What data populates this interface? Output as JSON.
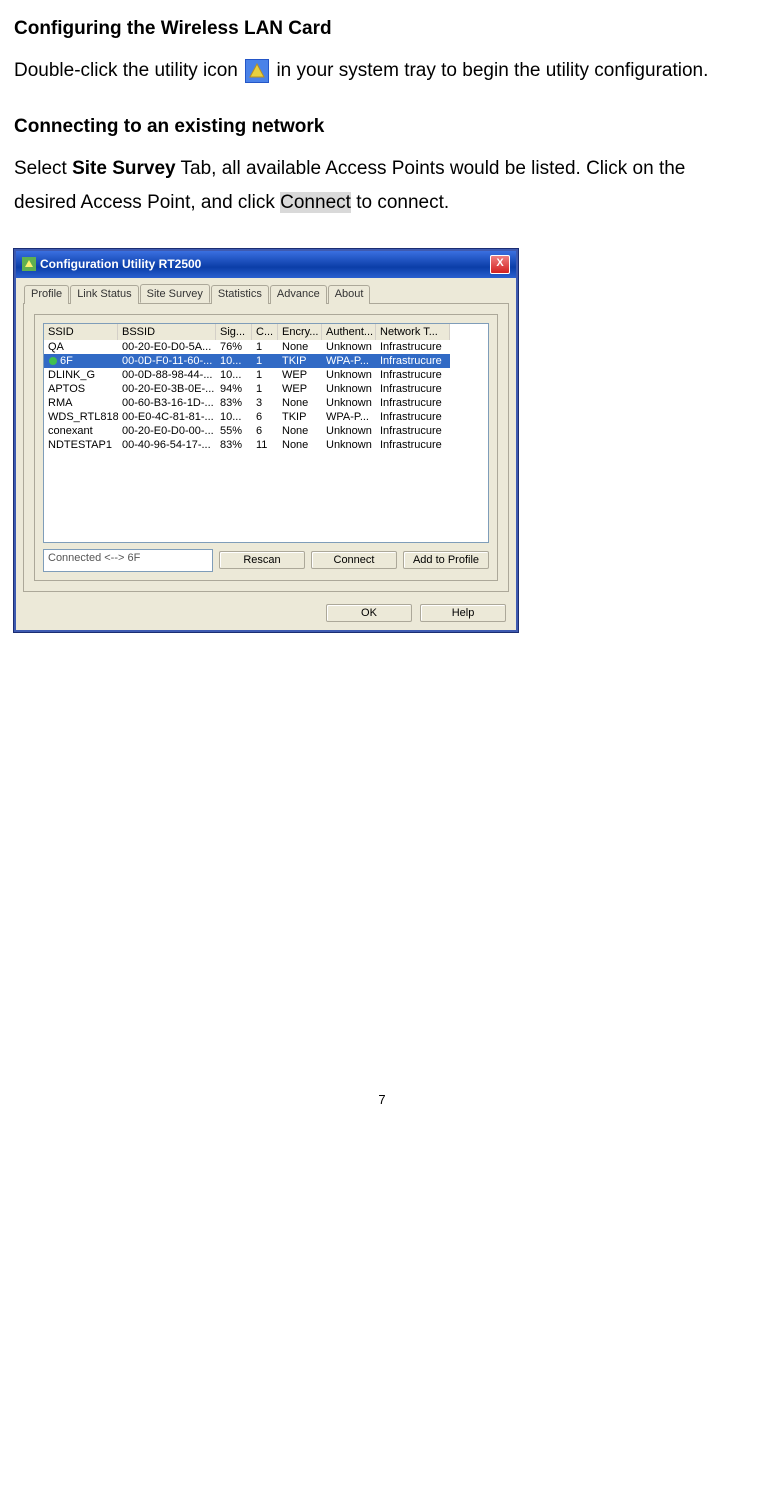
{
  "heading1": "Configuring the Wireless LAN Card",
  "p1a": "Double-click the utility icon ",
  "p1b": " in your system tray to begin the utility configuration.",
  "heading2": "Connecting to an existing network",
  "p2a": "Select ",
  "p2b": "Site Survey",
  "p2c": " Tab, all available Access Points would be listed. Click on the desired Access Point, and click ",
  "p2d": "Connect",
  "p2e": " to connect.",
  "window": {
    "title": "Configuration Utility RT2500",
    "tabs": [
      "Profile",
      "Link Status",
      "Site Survey",
      "Statistics",
      "Advance",
      "About"
    ],
    "active_tab": 2,
    "columns": [
      "SSID",
      "BSSID",
      "Sig...",
      "C...",
      "Encry...",
      "Authent...",
      "Network T..."
    ],
    "rows": [
      {
        "ssid": "QA",
        "bssid": "00-20-E0-D0-5A...",
        "sig": "76%",
        "c": "1",
        "enc": "None",
        "auth": "Unknown",
        "net": "Infrastrucure",
        "sel": false,
        "icon": false
      },
      {
        "ssid": "6F",
        "bssid": "00-0D-F0-11-60-...",
        "sig": "10...",
        "c": "1",
        "enc": "TKIP",
        "auth": "WPA-P...",
        "net": "Infrastrucure",
        "sel": true,
        "icon": true
      },
      {
        "ssid": "DLINK_G",
        "bssid": "00-0D-88-98-44-...",
        "sig": "10...",
        "c": "1",
        "enc": "WEP",
        "auth": "Unknown",
        "net": "Infrastrucure",
        "sel": false,
        "icon": false
      },
      {
        "ssid": "APTOS",
        "bssid": "00-20-E0-3B-0E-...",
        "sig": "94%",
        "c": "1",
        "enc": "WEP",
        "auth": "Unknown",
        "net": "Infrastrucure",
        "sel": false,
        "icon": false
      },
      {
        "ssid": "RMA",
        "bssid": "00-60-B3-16-1D-...",
        "sig": "83%",
        "c": "3",
        "enc": "None",
        "auth": "Unknown",
        "net": "Infrastrucure",
        "sel": false,
        "icon": false
      },
      {
        "ssid": "WDS_RTL818...",
        "bssid": "00-E0-4C-81-81-...",
        "sig": "10...",
        "c": "6",
        "enc": "TKIP",
        "auth": "WPA-P...",
        "net": "Infrastrucure",
        "sel": false,
        "icon": false
      },
      {
        "ssid": "conexant",
        "bssid": "00-20-E0-D0-00-...",
        "sig": "55%",
        "c": "6",
        "enc": "None",
        "auth": "Unknown",
        "net": "Infrastrucure",
        "sel": false,
        "icon": false
      },
      {
        "ssid": "NDTESTAP1",
        "bssid": "00-40-96-54-17-...",
        "sig": "83%",
        "c": "11",
        "enc": "None",
        "auth": "Unknown",
        "net": "Infrastrucure",
        "sel": false,
        "icon": false
      }
    ],
    "status": "Connected <--> 6F",
    "buttons": {
      "rescan": "Rescan",
      "connect": "Connect",
      "add": "Add to Profile",
      "ok": "OK",
      "help": "Help"
    },
    "close": "X"
  },
  "page_number": "7"
}
